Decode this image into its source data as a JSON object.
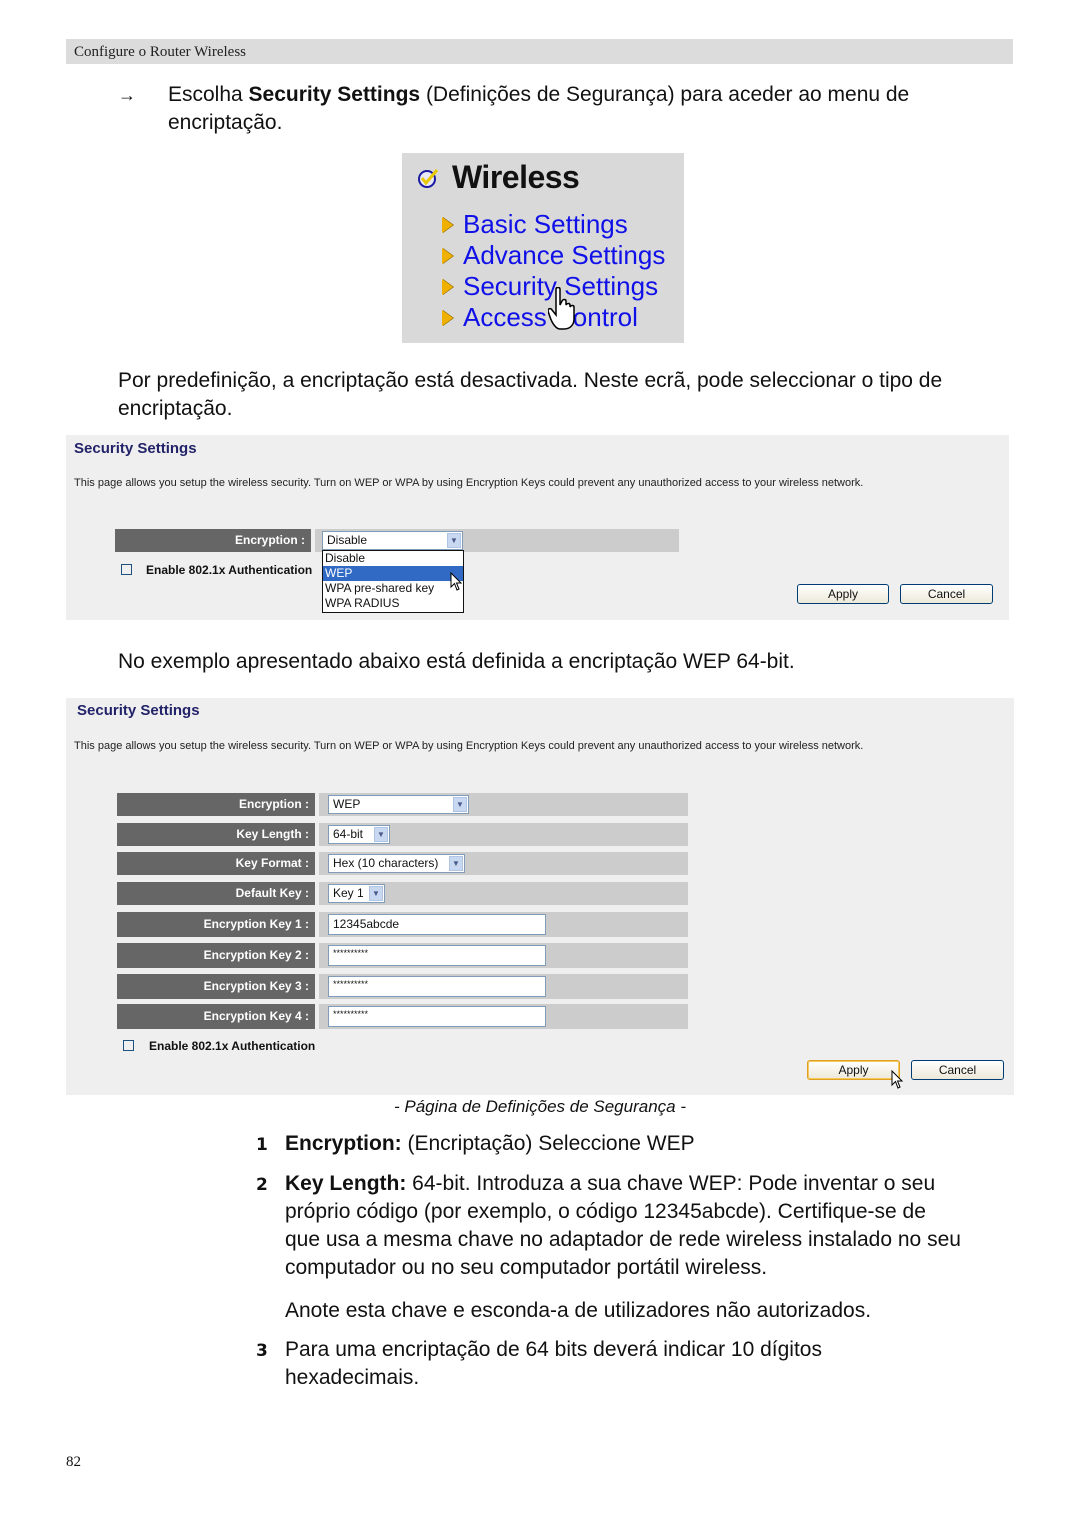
{
  "header": {
    "title": "Configure o Router Wireless"
  },
  "intro": {
    "arrow": "→",
    "prefix": "Escolha ",
    "bold": "Security Settings",
    "suffix": " (Definições de Segurança) para aceder ao menu de",
    "line2": "encriptação."
  },
  "wireless_menu": {
    "title": "Wireless",
    "items": [
      "Basic Settings",
      "Advance Settings",
      "Security Settings",
      "Access Control"
    ],
    "hovered_item": "Security Settings"
  },
  "para_default": {
    "line1": "Por predefinição, a encriptação está desactivada. Neste ecrã, pode seleccionar o tipo de",
    "line2": "encriptação."
  },
  "panel1": {
    "title": "Security Settings",
    "description": "This page allows you setup the wireless security. Turn on WEP or WPA by using Encryption Keys could prevent any unauthorized access to your wireless network.",
    "encryption_label": "Encryption :",
    "encryption_value": "Disable",
    "dropdown_options": [
      "Disable",
      "WEP",
      "WPA pre-shared key",
      "WPA RADIUS"
    ],
    "dropdown_highlighted": "WEP",
    "checkbox_label": "Enable 802.1x Authentication",
    "apply_label": "Apply",
    "cancel_label": "Cancel"
  },
  "para_example": "No exemplo apresentado abaixo está definida a encriptação WEP 64-bit.",
  "panel2": {
    "title": "Security Settings",
    "description": "This page allows you setup the wireless security. Turn on WEP or WPA by using Encryption Keys could prevent any unauthorized access to your wireless network.",
    "rows": [
      {
        "label": "Encryption :",
        "type": "select",
        "value": "WEP"
      },
      {
        "label": "Key Length :",
        "type": "select",
        "value": "64-bit"
      },
      {
        "label": "Key Format :",
        "type": "select",
        "value": "Hex (10 characters)"
      },
      {
        "label": "Default Key :",
        "type": "select",
        "value": "Key 1"
      },
      {
        "label": "Encryption Key 1 :",
        "type": "text",
        "value": "12345abcde"
      },
      {
        "label": "Encryption Key 2 :",
        "type": "text",
        "value": "**********"
      },
      {
        "label": "Encryption Key 3 :",
        "type": "text",
        "value": "**********"
      },
      {
        "label": "Encryption Key 4 :",
        "type": "text",
        "value": "**********"
      }
    ],
    "checkbox_label": "Enable 802.1x Authentication",
    "apply_label": "Apply",
    "cancel_label": "Cancel"
  },
  "caption": "- Página de Definições de Segurança -",
  "steps": [
    {
      "num": "1",
      "bold": "Encryption:",
      "text": " (Encriptação) Seleccione WEP"
    },
    {
      "num": "2",
      "bold": "Key Length:",
      "text": " 64-bit. Introduza a sua chave WEP: Pode inventar o seu",
      "lines": [
        "próprio código (por exemplo, o código 12345abcde). Certifique-se de",
        "que usa a mesma chave no adaptador de rede wireless instalado no seu",
        "computador ou no seu computador portátil wireless."
      ]
    },
    {
      "num": "3",
      "text": "Para uma encriptação de 64 bits deverá indicar 10 dígitos",
      "lines": [
        "hexadecimais."
      ]
    }
  ],
  "note": "Anote esta chave e esconda-a de utilizadores não autorizados.",
  "page_number": "82"
}
